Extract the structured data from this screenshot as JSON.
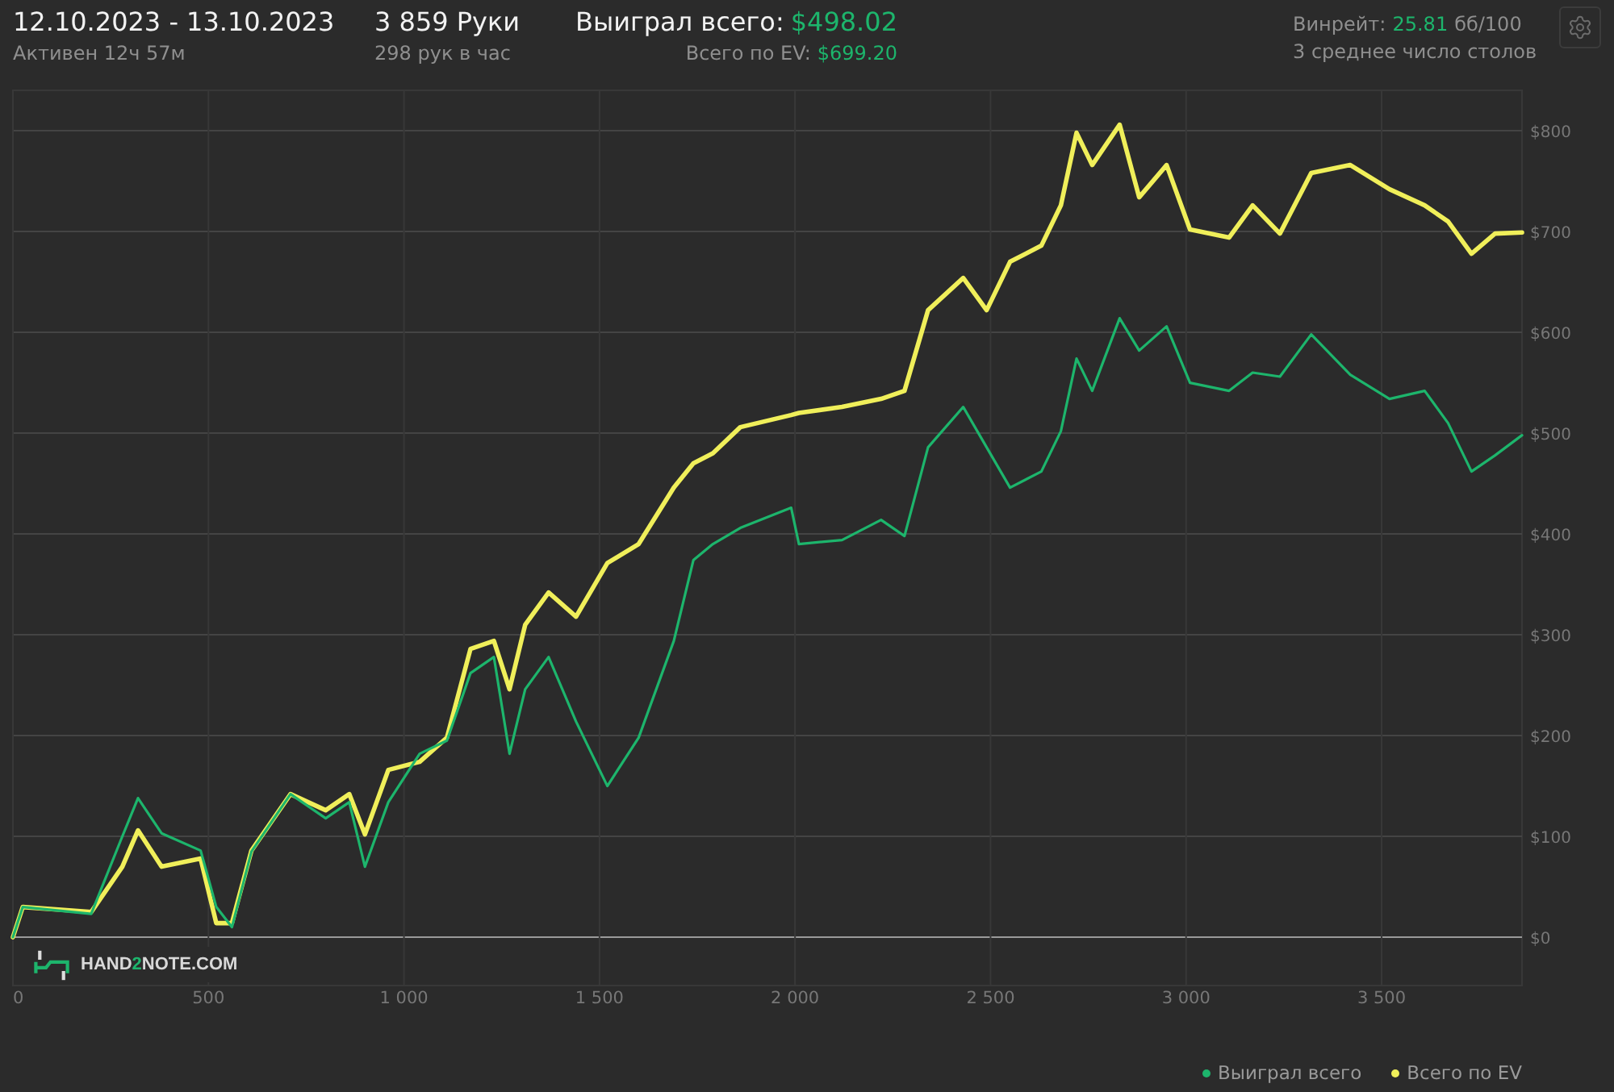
{
  "header": {
    "date_range": "12.10.2023 - 13.10.2023",
    "active_time": "Активен 12ч 57м",
    "hands": "3 859 Руки",
    "hands_per_hour": "298 рук в час",
    "won_label": "Выиграл всего:",
    "won_value": "$498.02",
    "ev_label": "Всего по EV:",
    "ev_value": "$699.20",
    "winrate_label": "Винрейт:",
    "winrate_value": "25.81",
    "winrate_unit": "бб/100",
    "avg_tables": "3 среднее число столов"
  },
  "logo": {
    "parts": [
      "HAND",
      "2",
      "NOTE.COM"
    ]
  },
  "chart": {
    "chart_data": {
      "type": "line",
      "x": [
        0,
        25,
        200,
        280,
        320,
        380,
        480,
        520,
        560,
        610,
        710,
        800,
        860,
        900,
        960,
        1040,
        1110,
        1170,
        1230,
        1270,
        1310,
        1370,
        1440,
        1520,
        1600,
        1690,
        1740,
        1790,
        1860,
        1990,
        2010,
        2120,
        2220,
        2280,
        2340,
        2430,
        2490,
        2550,
        2630,
        2680,
        2720,
        2760,
        2830,
        2880,
        2950,
        3010,
        3110,
        3170,
        3240,
        3320,
        3420,
        3520,
        3610,
        3670,
        3730,
        3790,
        3859
      ],
      "series": [
        {
          "name": "Выиграл всего",
          "color": "#1db56c",
          "values": [
            0,
            30,
            23,
            100,
            138,
            103,
            86,
            30,
            10,
            85,
            142,
            118,
            134,
            70,
            134,
            182,
            195,
            262,
            278,
            182,
            246,
            278,
            214,
            150,
            198,
            294,
            374,
            390,
            406,
            426,
            390,
            394,
            414,
            398,
            486,
            526,
            486,
            446,
            462,
            502,
            574,
            542,
            614,
            582,
            606,
            550,
            542,
            560,
            556,
            598,
            558,
            534,
            542,
            510,
            462,
            478,
            498
          ]
        },
        {
          "name": "Всего по EV",
          "color": "#f0ef5a",
          "values": [
            0,
            30,
            25,
            70,
            106,
            70,
            78,
            14,
            14,
            86,
            142,
            126,
            142,
            102,
            166,
            174,
            198,
            286,
            294,
            246,
            310,
            342,
            318,
            371,
            390,
            446,
            470,
            480,
            506,
            518,
            520,
            526,
            534,
            542,
            622,
            654,
            622,
            670,
            686,
            726,
            798,
            766,
            806,
            734,
            766,
            702,
            694,
            726,
            698,
            758,
            766,
            742,
            726,
            710,
            678,
            698,
            699
          ]
        }
      ],
      "grid": true,
      "xlim": [
        0,
        3859
      ],
      "ylim": [
        -48,
        840
      ],
      "xticks": [
        {
          "value": 0,
          "label": "0"
        },
        {
          "value": 500,
          "label": "500"
        },
        {
          "value": 1000,
          "label": "1 000"
        },
        {
          "value": 1500,
          "label": "1 500"
        },
        {
          "value": 2000,
          "label": "2 000"
        },
        {
          "value": 2500,
          "label": "2 500"
        },
        {
          "value": 3000,
          "label": "3 000"
        },
        {
          "value": 3500,
          "label": "3 500"
        }
      ],
      "yticks": [
        {
          "value": 0,
          "label": "$0"
        },
        {
          "value": 100,
          "label": "$100"
        },
        {
          "value": 200,
          "label": "$200"
        },
        {
          "value": 300,
          "label": "$300"
        },
        {
          "value": 400,
          "label": "$400"
        },
        {
          "value": 500,
          "label": "$500"
        },
        {
          "value": 600,
          "label": "$600"
        },
        {
          "value": 700,
          "label": "$700"
        },
        {
          "value": 800,
          "label": "$800"
        }
      ]
    }
  }
}
